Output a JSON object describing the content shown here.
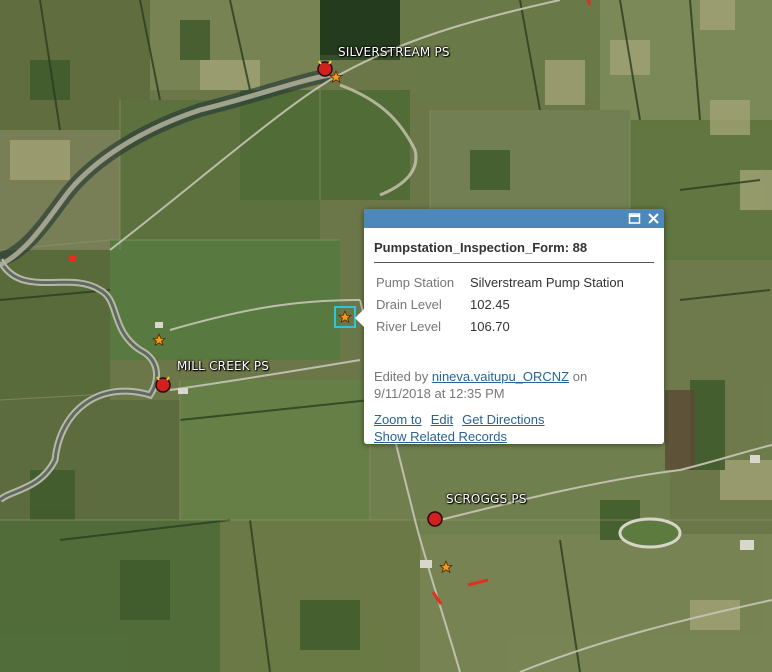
{
  "map": {
    "features": [
      {
        "label": "SILVERSTREAM PS",
        "type": "pump-station"
      },
      {
        "label": "MILL CREEK PS",
        "type": "pump-station"
      },
      {
        "label": "SCROGGS PS",
        "type": "pump-station"
      }
    ],
    "colors": {
      "pump_station": "#d21f1f",
      "inspection_star": "#f39a1e",
      "selection": "#2ec4d9",
      "popup_header": "#4c89ba"
    }
  },
  "popup": {
    "title": "Pumpstation_Inspection_Form: 88",
    "fields": [
      {
        "name": "Pump Station",
        "value": "Silverstream Pump Station"
      },
      {
        "name": "Drain Level",
        "value": "102.45"
      },
      {
        "name": "River Level",
        "value": "106.70"
      }
    ],
    "edited_prefix": "Edited by ",
    "edited_user": "nineva.vaitupu_ORCNZ",
    "edited_on": " on",
    "edited_date": "9/11/2018 at 12:35 PM",
    "actions": {
      "zoom_to": "Zoom to",
      "edit": "Edit",
      "get_directions": "Get Directions",
      "show_related": "Show Related Records"
    },
    "icons": [
      "maximize-icon",
      "close-icon"
    ]
  }
}
